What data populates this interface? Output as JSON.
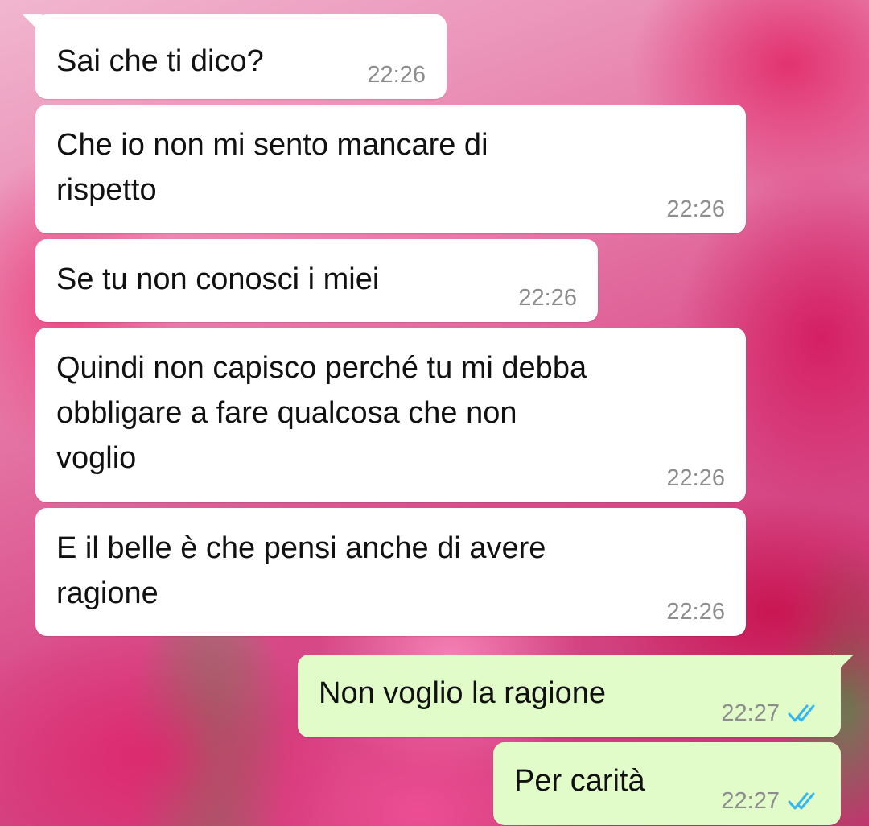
{
  "messages": [
    {
      "text": "Sai che ti dico?",
      "time": "22:26",
      "direction": "incoming"
    },
    {
      "text": "Che io non mi sento mancare di\nrispetto",
      "time": "22:26",
      "direction": "incoming"
    },
    {
      "text": "Se tu non conosci i miei",
      "time": "22:26",
      "direction": "incoming"
    },
    {
      "text": "Quindi non capisco perché tu mi debba\nobbligare a fare qualcosa che non\nvoglio",
      "time": "22:26",
      "direction": "incoming"
    },
    {
      "text": "E il belle è che pensi anche di avere\nragione",
      "time": "22:26",
      "direction": "incoming"
    },
    {
      "text": "Non voglio la ragione",
      "time": "22:27",
      "direction": "outgoing",
      "status_icon": "double-check-read-icon"
    },
    {
      "text": "Per carità",
      "time": "22:27",
      "direction": "outgoing",
      "status_icon": "double-check-read-icon"
    }
  ],
  "colors": {
    "incoming_bubble": "#ffffff",
    "outgoing_bubble": "#e2fcc9",
    "timestamp": "#8d8d8d",
    "read_ticks": "#34b7f1"
  }
}
